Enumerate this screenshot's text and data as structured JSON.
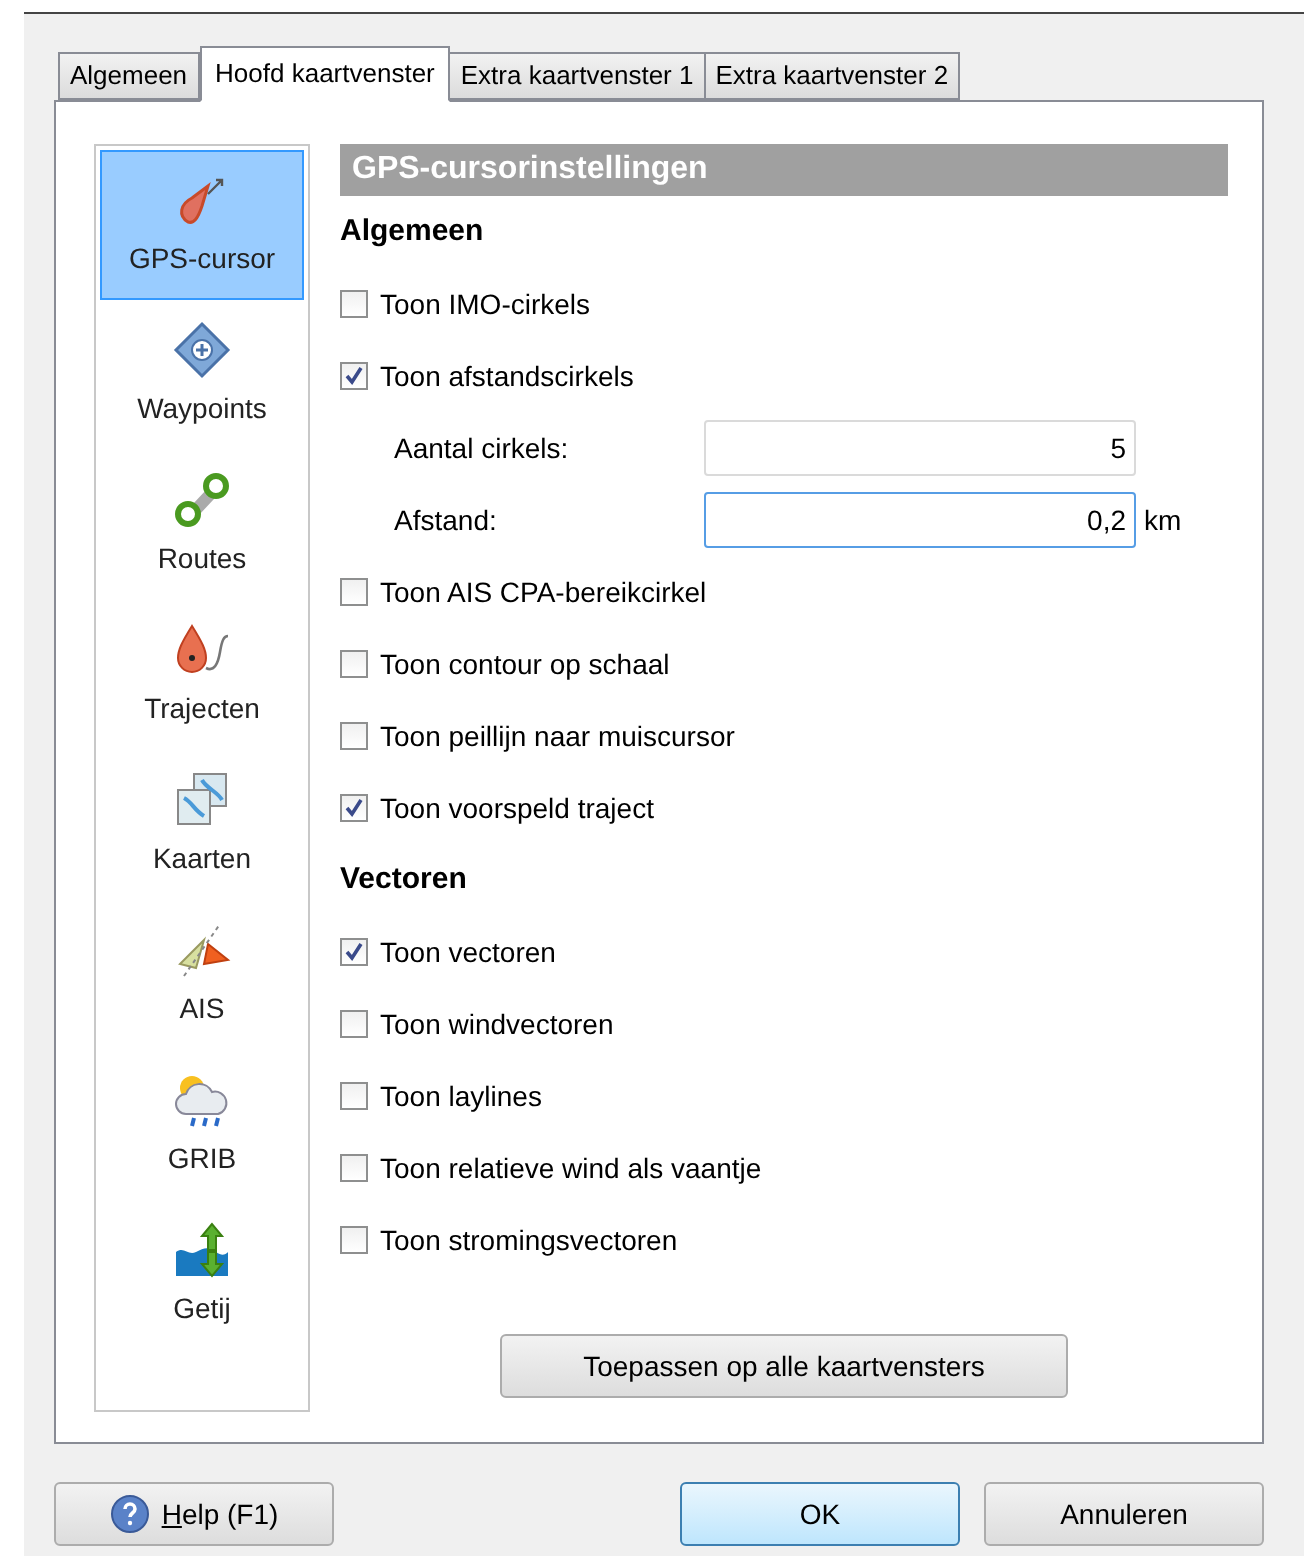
{
  "tabs": [
    {
      "label": "Algemeen",
      "selected": false
    },
    {
      "label": "Hoofd kaartvenster",
      "selected": true
    },
    {
      "label": "Extra kaartvenster 1",
      "selected": false
    },
    {
      "label": "Extra kaartvenster 2",
      "selected": false
    }
  ],
  "sidebar": {
    "items": [
      {
        "label": "GPS-cursor",
        "kind": "gps",
        "selected": true
      },
      {
        "label": "Waypoints",
        "kind": "waypoint",
        "selected": false
      },
      {
        "label": "Routes",
        "kind": "route",
        "selected": false
      },
      {
        "label": "Trajecten",
        "kind": "track",
        "selected": false
      },
      {
        "label": "Kaarten",
        "kind": "maps",
        "selected": false
      },
      {
        "label": "AIS",
        "kind": "ais",
        "selected": false
      },
      {
        "label": "GRIB",
        "kind": "weather",
        "selected": false
      },
      {
        "label": "Getij",
        "kind": "tide",
        "selected": false
      }
    ]
  },
  "panel": {
    "title": "GPS-cursorinstellingen",
    "settings": [
      {
        "kind": "heading",
        "label": "Algemeen"
      },
      {
        "kind": "checkbox",
        "label": "Toon IMO-cirkels",
        "checked": false
      },
      {
        "kind": "checkbox",
        "label": "Toon afstandscirkels",
        "checked": true
      },
      {
        "kind": "field",
        "label": "Aantal cirkels:",
        "value": "5",
        "focused": false
      },
      {
        "kind": "field",
        "label": "Afstand:",
        "value": "0,2",
        "unit": "km",
        "focused": true
      },
      {
        "kind": "checkbox",
        "label": "Toon AIS CPA-bereikcirkel",
        "checked": false
      },
      {
        "kind": "checkbox",
        "label": "Toon contour op schaal",
        "checked": false
      },
      {
        "kind": "checkbox",
        "label": "Toon peillijn naar muiscursor",
        "checked": false
      },
      {
        "kind": "checkbox",
        "label": "Toon voorspeld traject",
        "checked": true
      },
      {
        "kind": "heading",
        "label": "Vectoren"
      },
      {
        "kind": "checkbox",
        "label": "Toon vectoren",
        "checked": true
      },
      {
        "kind": "checkbox",
        "label": "Toon windvectoren",
        "checked": false
      },
      {
        "kind": "checkbox",
        "label": "Toon laylines",
        "checked": false
      },
      {
        "kind": "checkbox",
        "label": "Toon relatieve wind als vaantje",
        "checked": false
      },
      {
        "kind": "checkbox",
        "label": "Toon stromingsvectoren",
        "checked": false
      }
    ],
    "apply_button": "Toepassen op alle kaartvensters"
  },
  "buttons": [
    {
      "label": "Help (F1)",
      "kind": "help",
      "default": false
    },
    {
      "label": "OK",
      "kind": "plain",
      "default": true
    },
    {
      "label": "Annuleren",
      "kind": "plain",
      "default": false
    }
  ]
}
